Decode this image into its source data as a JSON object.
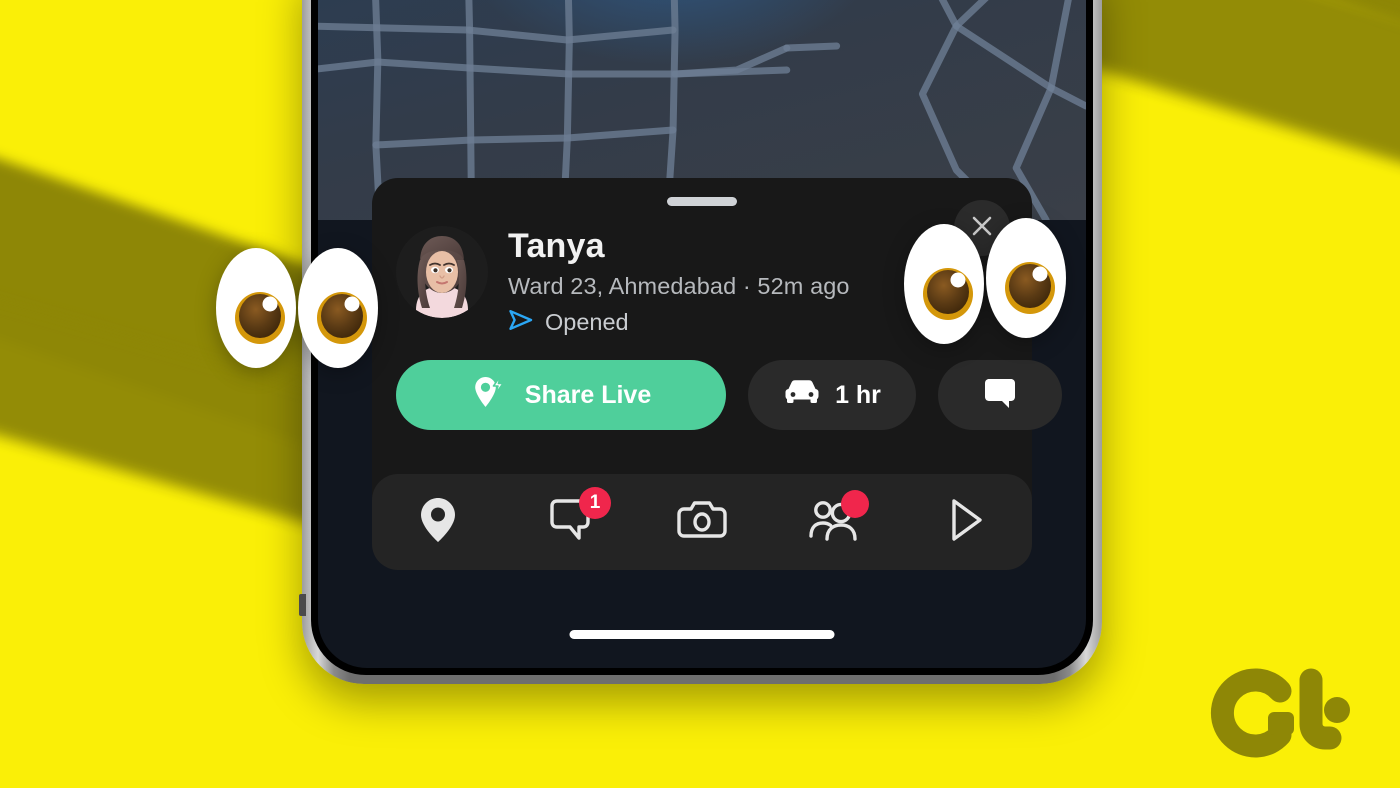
{
  "background": {
    "color": "#FAEF07",
    "ray_color": "#8E8706"
  },
  "phone": {
    "frame_color": "#8a8a8a",
    "screen_bg": "#11161f",
    "home_indicator": "home-indicator"
  },
  "map": {
    "name": "snap-map",
    "base_color": "#333c49",
    "glow_color": "#2f567f",
    "road_color": "#6d7d93"
  },
  "sheet": {
    "bg_color": "#181818",
    "grabber": "drag-handle",
    "profile": {
      "avatar_alt": "Bitmoji avatar",
      "name": "Tanya",
      "location_time": "Ward 23, Ahmedabad · 52m ago",
      "status_label": "Opened",
      "status_icon": "send-arrow-icon",
      "status_icon_color": "#2BA7F5"
    },
    "close_button": {
      "label": "close-button",
      "icon": "close-x-icon"
    },
    "actions": [
      {
        "id": "share-live",
        "label": "Share Live",
        "icon": "live-location-bolt-icon",
        "bg": "#4FCF9B",
        "text_color": "#ffffff"
      },
      {
        "id": "eta",
        "label": "1 hr",
        "icon": "car-icon",
        "bg": "#2a2a2a",
        "text_color": "#ffffff"
      },
      {
        "id": "chat",
        "label": "",
        "icon": "chat-bubble-icon",
        "bg": "#2a2a2a",
        "text_color": "#ffffff"
      }
    ]
  },
  "navbar": {
    "bg_color": "#242424",
    "items": [
      {
        "id": "map",
        "icon": "map-pin-icon",
        "badge": null,
        "badge_type": "none"
      },
      {
        "id": "chat",
        "icon": "chat-bubble-icon",
        "badge": "1",
        "badge_type": "count"
      },
      {
        "id": "camera",
        "icon": "camera-icon",
        "badge": null,
        "badge_type": "none"
      },
      {
        "id": "friends",
        "icon": "friends-icon",
        "badge": "",
        "badge_type": "dot"
      },
      {
        "id": "stories",
        "icon": "play-triangle-icon",
        "badge": null,
        "badge_type": "none"
      }
    ],
    "badge_color": "#F0264C"
  },
  "overlay": {
    "eyes_left": "eyes-emoji",
    "eyes_right": "eyes-emoji"
  },
  "logo": {
    "name": "guiding-tech-logo",
    "text": "GT",
    "color": "#8E8706"
  }
}
